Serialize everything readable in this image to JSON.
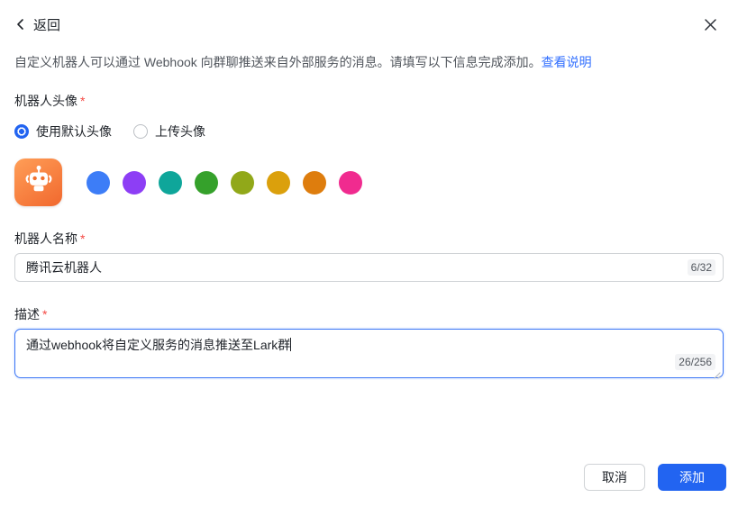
{
  "header": {
    "back_label": "返回",
    "close_icon": "close"
  },
  "intro": {
    "text": "自定义机器人可以通过 Webhook 向群聊推送来自外部服务的消息。请填写以下信息完成添加。",
    "link_label": "查看说明"
  },
  "form": {
    "avatar": {
      "label": "机器人头像",
      "required_mark": "*",
      "radio_default_label": "使用默认头像",
      "radio_upload_label": "上传头像",
      "selected_option": "使用默认头像",
      "colors": [
        "#3D7DF7",
        "#8D3EF5",
        "#0FA69A",
        "#35A12B",
        "#91A819",
        "#DBA00C",
        "#DE7D0D",
        "#F02B8F"
      ]
    },
    "name": {
      "label": "机器人名称",
      "required_mark": "*",
      "value": "腾讯云机器人",
      "counter": "6/32",
      "max_length": "32"
    },
    "description": {
      "label": "描述",
      "required_mark": "*",
      "value": "通过webhook将自定义服务的消息推送至Lark群",
      "counter": "26/256",
      "max_length": "256"
    }
  },
  "footer": {
    "cancel_label": "取消",
    "add_label": "添加"
  },
  "colors": {
    "primary_blue": "#2264F1",
    "link_blue": "#3370FF",
    "danger_red": "#F54A45",
    "avatar_orange_start": "#FF9E57",
    "avatar_orange_end": "#F1682E"
  }
}
